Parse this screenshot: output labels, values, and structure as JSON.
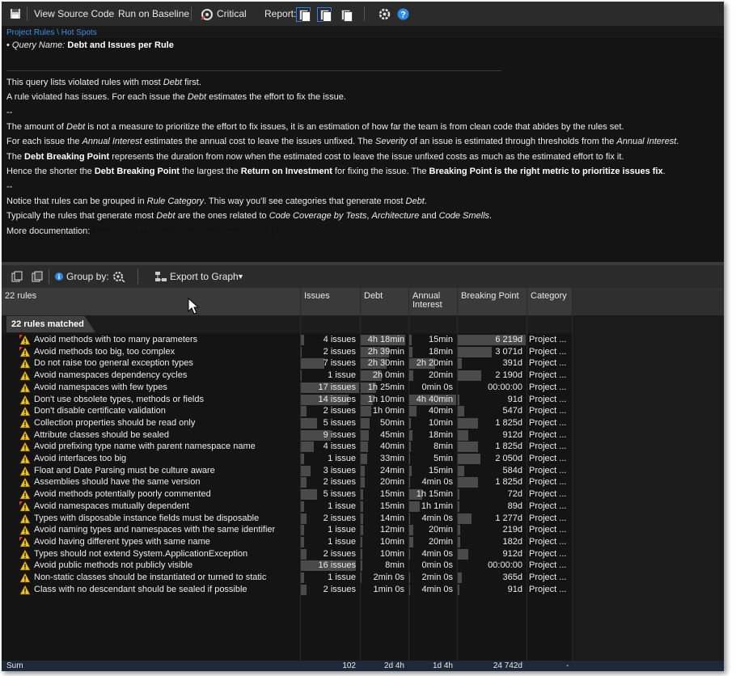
{
  "toolbar": {
    "view_source": "View Source Code",
    "run_baseline": "Run on Baseline",
    "critical": "Critical",
    "report": "Report:"
  },
  "breadcrumb": "Project Rules \\ Hot Spots",
  "description": {
    "query_label": "Query Name:",
    "query_name": "Debt and Issues per Rule",
    "l1a": "This query lists violated rules with most ",
    "l1b": "Debt",
    "l1c": " first.",
    "l2a": "A rule violated has issues. For each issue the ",
    "l2b": "Debt",
    "l2c": " estimates the effort to fix the issue.",
    "dash1": "--",
    "l3a": "The amount of ",
    "l3b": "Debt",
    "l3c": " is not a measure to prioritize the effort to fix issues, it is an estimation of how far the team is from clean code that abides by the rules set.",
    "l4a": "For each issue the ",
    "l4b": "Annual Interest",
    "l4c": " estimates the annual cost to leave the issues unfixed. The ",
    "l4d": "Severity",
    "l4e": " of an issue is estimated through thresholds from the ",
    "l4f": "Annual Interest",
    "l4g": ".",
    "l5a": "The ",
    "l5b": "Debt Breaking Point",
    "l5c": " represents the duration from now when the estimated cost to leave the issue unfixed costs as much as the estimated effort to fix it.",
    "l6a": "Hence the shorter the ",
    "l6b": "Debt Breaking Point",
    "l6c": " the largest the ",
    "l6d": "Return on Investment",
    "l6e": " for fixing the issue. The ",
    "l6f": "Breaking Point is the right metric to prioritize issues fix",
    "l6g": ".",
    "dash2": "--",
    "l7a": "Notice that rules can be grouped in ",
    "l7b": "Rule Category",
    "l7c": ". This way you'll see categories that generate most ",
    "l7d": "Debt",
    "l7e": ".",
    "l8a": "Typically the rules that generate most ",
    "l8b": "Debt",
    "l8c": " are the ones related to ",
    "l8d": "Code Coverage by Tests",
    "l8e": ", ",
    "l8f": "Architecture",
    "l8g": " and ",
    "l8h": "Code Smells",
    "l8i": ".",
    "l9a": "More documentation: ",
    "l9b": "https://www.ndepend.com/docs/technical-debt"
  },
  "toolbar2": {
    "group_by": "Group by:",
    "export": "Export to Graph"
  },
  "grid": {
    "headers": {
      "name": "22 rules",
      "issues": "Issues",
      "debt": "Debt",
      "ai1": "Annual",
      "ai2": "Interest",
      "bp": "Breaking Point",
      "cat": "Category"
    },
    "group_label": "22 rules matched",
    "rows": [
      {
        "name": "Avoid methods with too many parameters",
        "issues": "4 issues",
        "debt": "4h  18min",
        "ai": "15min",
        "bp": "6 219d",
        "cat": "Project ...",
        "critical": true,
        "ib": 0.05,
        "db": 0.95,
        "ab": 0.06,
        "bb": 1.0
      },
      {
        "name": "Avoid methods too big, too complex",
        "issues": "2 issues",
        "debt": "2h  39min",
        "ai": "18min",
        "bp": "3 071d",
        "cat": "Project ...",
        "critical": true,
        "ib": 0.02,
        "db": 0.6,
        "ab": 0.07,
        "bb": 0.5
      },
      {
        "name": "Do not raise too general exception types",
        "issues": "7 issues",
        "debt": "2h  30min",
        "ai": "2h  20min",
        "bp": "391d",
        "cat": "Project ...",
        "critical": false,
        "ib": 0.4,
        "db": 0.56,
        "ab": 0.55,
        "bb": 0.06
      },
      {
        "name": "Avoid namespaces dependency cycles",
        "issues": "1 issue",
        "debt": "2h  0min",
        "ai": "20min",
        "bp": "2 190d",
        "cat": "Project ...",
        "critical": false,
        "ib": 0.02,
        "db": 0.45,
        "ab": 0.08,
        "bb": 0.35
      },
      {
        "name": "Avoid namespaces with few types",
        "issues": "17 issues",
        "debt": "1h  25min",
        "ai": "0min  0s",
        "bp": "00:00:00",
        "cat": "Project ...",
        "critical": false,
        "ib": 1.0,
        "db": 0.32,
        "ab": 0.0,
        "bb": 0.0
      },
      {
        "name": "Don't use obsolete types, methods or fields",
        "issues": "14 issues",
        "debt": "1h  10min",
        "ai": "4h  40min",
        "bp": "91d",
        "cat": "Project ...",
        "critical": false,
        "ib": 0.82,
        "db": 0.26,
        "ab": 1.0,
        "bb": 0.02
      },
      {
        "name": "Don't disable certificate validation",
        "issues": "2 issues",
        "debt": "1h  0min",
        "ai": "40min",
        "bp": "547d",
        "cat": "Project ...",
        "critical": false,
        "ib": 0.1,
        "db": 0.23,
        "ab": 0.15,
        "bb": 0.09
      },
      {
        "name": "Collection properties should be read only",
        "issues": "5 issues",
        "debt": "50min",
        "ai": "10min",
        "bp": "1 825d",
        "cat": "Project ...",
        "critical": false,
        "ib": 0.28,
        "db": 0.19,
        "ab": 0.04,
        "bb": 0.3
      },
      {
        "name": "Attribute classes should be sealed",
        "issues": "9 issues",
        "debt": "45min",
        "ai": "18min",
        "bp": "912d",
        "cat": "Project ...",
        "critical": false,
        "ib": 0.52,
        "db": 0.17,
        "ab": 0.07,
        "bb": 0.15
      },
      {
        "name": "Avoid prefixing type name with parent namespace name",
        "issues": "4 issues",
        "debt": "40min",
        "ai": "8min",
        "bp": "1 825d",
        "cat": "Project ...",
        "critical": false,
        "ib": 0.22,
        "db": 0.15,
        "ab": 0.03,
        "bb": 0.3
      },
      {
        "name": "Avoid interfaces too big",
        "issues": "1 issue",
        "debt": "33min",
        "ai": "5min",
        "bp": "2 050d",
        "cat": "Project ...",
        "critical": false,
        "ib": 0.05,
        "db": 0.13,
        "ab": 0.02,
        "bb": 0.33
      },
      {
        "name": "Float and Date Parsing must be culture aware",
        "issues": "3 issues",
        "debt": "24min",
        "ai": "15min",
        "bp": "584d",
        "cat": "Project ...",
        "critical": false,
        "ib": 0.16,
        "db": 0.09,
        "ab": 0.06,
        "bb": 0.1
      },
      {
        "name": "Assemblies should have the same version",
        "issues": "2 issues",
        "debt": "20min",
        "ai": "4min  0s",
        "bp": "1 825d",
        "cat": "Project ...",
        "critical": false,
        "ib": 0.1,
        "db": 0.08,
        "ab": 0.02,
        "bb": 0.3
      },
      {
        "name": "Avoid methods potentially poorly commented",
        "issues": "5 issues",
        "debt": "15min",
        "ai": "1h  15min",
        "bp": "72d",
        "cat": "Project ...",
        "critical": false,
        "ib": 0.28,
        "db": 0.06,
        "ab": 0.28,
        "bb": 0.02
      },
      {
        "name": "Avoid namespaces mutually dependent",
        "issues": "1 issue",
        "debt": "15min",
        "ai": "1h  1min",
        "bp": "89d",
        "cat": "Project ...",
        "critical": true,
        "ib": 0.05,
        "db": 0.06,
        "ab": 0.22,
        "bb": 0.02
      },
      {
        "name": "Types with disposable instance fields must be disposable",
        "issues": "2 issues",
        "debt": "14min",
        "ai": "4min  0s",
        "bp": "1 277d",
        "cat": "Project ...",
        "critical": false,
        "ib": 0.1,
        "db": 0.05,
        "ab": 0.02,
        "bb": 0.2
      },
      {
        "name": "Avoid naming types and namespaces with the same identifier",
        "issues": "1 issue",
        "debt": "12min",
        "ai": "20min",
        "bp": "219d",
        "cat": "Project ...",
        "critical": false,
        "ib": 0.05,
        "db": 0.05,
        "ab": 0.08,
        "bb": 0.04
      },
      {
        "name": "Avoid having different types with same name",
        "issues": "1 issue",
        "debt": "10min",
        "ai": "20min",
        "bp": "182d",
        "cat": "Project ...",
        "critical": true,
        "ib": 0.05,
        "db": 0.04,
        "ab": 0.08,
        "bb": 0.03
      },
      {
        "name": "Types should not extend System.ApplicationException",
        "issues": "2 issues",
        "debt": "10min",
        "ai": "4min  0s",
        "bp": "912d",
        "cat": "Project ...",
        "critical": false,
        "ib": 0.1,
        "db": 0.04,
        "ab": 0.02,
        "bb": 0.15
      },
      {
        "name": "Avoid public methods not publicly visible",
        "issues": "16 issues",
        "debt": "8min",
        "ai": "0min  0s",
        "bp": "00:00:00",
        "cat": "Project ...",
        "critical": false,
        "ib": 0.94,
        "db": 0.03,
        "ab": 0.0,
        "bb": 0.0
      },
      {
        "name": "Non-static classes should be instantiated or turned to static",
        "issues": "1 issue",
        "debt": "2min  0s",
        "ai": "2min  0s",
        "bp": "365d",
        "cat": "Project ...",
        "critical": false,
        "ib": 0.05,
        "db": 0.01,
        "ab": 0.01,
        "bb": 0.06
      },
      {
        "name": "Class with no descendant should be sealed if possible",
        "issues": "2 issues",
        "debt": "1min  0s",
        "ai": "4min  0s",
        "bp": "91d",
        "cat": "Project ...",
        "critical": false,
        "ib": 0.1,
        "db": 0.0,
        "ab": 0.02,
        "bb": 0.02
      }
    ]
  },
  "footer": {
    "label": "Sum",
    "issues": "102",
    "debt": "2d  4h",
    "ai": "1d  4h",
    "bp": "24 742d",
    "cat": "-"
  }
}
